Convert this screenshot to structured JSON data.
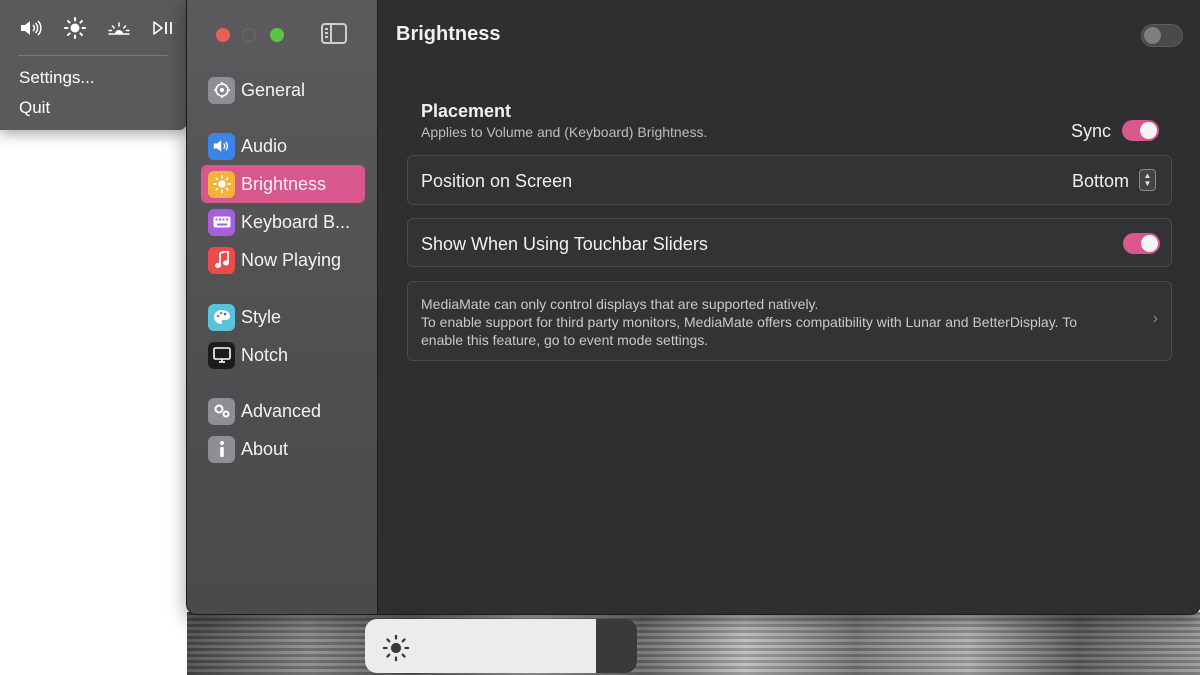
{
  "menu_popup": {
    "icons": [
      "speaker-icon",
      "sun-icon",
      "sunrise-icon",
      "play-pause-icon"
    ],
    "items": [
      {
        "label": "Settings..."
      },
      {
        "label": "Quit"
      }
    ]
  },
  "window": {
    "sidebar": {
      "items": [
        {
          "label": "General",
          "icon": "gear-icon",
          "color": "#8e8e93"
        },
        {
          "label": "Audio",
          "icon": "speaker-icon",
          "color": "#3d84e8"
        },
        {
          "label": "Brightness",
          "icon": "sun-icon",
          "color": "#f2b33d",
          "active": true
        },
        {
          "label": "Keyboard B...",
          "icon": "keyboard-icon",
          "color": "#a65fdd"
        },
        {
          "label": "Now Playing",
          "icon": "music-note-icon",
          "color": "#ec4b4b"
        },
        {
          "label": "Style",
          "icon": "palette-icon",
          "color": "#58c3d9"
        },
        {
          "label": "Notch",
          "icon": "display-icon",
          "color": "#1c1c1c"
        },
        {
          "label": "Advanced",
          "icon": "gears-icon",
          "color": "#8e8e93"
        },
        {
          "label": "About",
          "icon": "info-icon",
          "color": "#8e8e93"
        }
      ]
    },
    "main": {
      "title": "Brightness",
      "enabled": false,
      "placement": {
        "title": "Placement",
        "subtitle": "Applies to Volume and (Keyboard) Brightness.",
        "sync_label": "Sync",
        "sync_on": true
      },
      "position_row": {
        "label": "Position on Screen",
        "value": "Bottom"
      },
      "touchbar_row": {
        "label": "Show When Using Touchbar Sliders",
        "on": true
      },
      "info_box": {
        "line1": "MediaMate can only control displays that are supported natively.",
        "line2": "To enable support for third party monitors, MediaMate offers compatibility with Lunar and BetterDisplay. To",
        "line3": "enable this feature, go to event mode settings."
      }
    }
  },
  "hud": {
    "icon": "sun-icon",
    "level": 0.85
  },
  "colors": {
    "accent": "#d8578c",
    "window_bg": "#2f2f31"
  }
}
